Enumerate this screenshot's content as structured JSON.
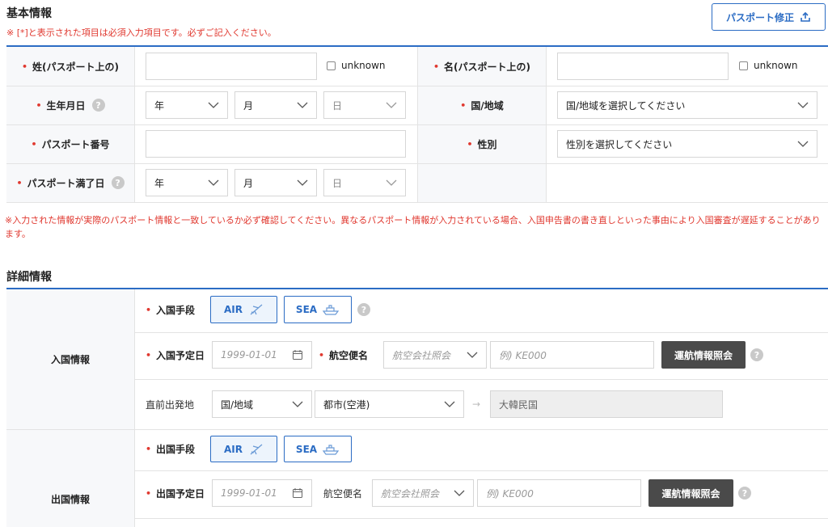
{
  "basic": {
    "title": "基本情報",
    "required_note": "※ [*]と表示された項目は必須入力項目です。必ずご記入ください。",
    "passport_edit_label": "パスポート修正",
    "surname_label": "姓(パスポート上の)",
    "given_label": "名(パスポート上の)",
    "unknown_label": "unknown",
    "dob_label": "生年月日",
    "year_placeholder": "年",
    "month_placeholder": "月",
    "day_placeholder": "日",
    "country_label": "国/地域",
    "country_placeholder": "国/地域を選択してください",
    "passport_no_label": "パスポート番号",
    "gender_label": "性別",
    "gender_placeholder": "性別を選択してください",
    "expiry_label": "パスポート満了日",
    "warning": "※入力された情報が実際のパスポート情報と一致しているか必ず確認してください。異なるパスポート情報が入力されている場合、入国申告書の書き直しといった事由により入国審査が遅延することがあります。",
    "help_glyph": "?",
    "star_glyph": "•"
  },
  "detail": {
    "title": "詳細情報",
    "entry": {
      "section_label": "入国情報",
      "mode_label": "入国手段",
      "air_label": "AIR",
      "sea_label": "SEA",
      "date_label": "入国予定日",
      "date_placeholder": "1999-01-01",
      "flight_label": "航空便名",
      "airline_placeholder": "航空会社照会",
      "flight_placeholder": "例) KE000",
      "lookup_label": "運航情報照会",
      "origin_label": "直前出発地",
      "origin_country": "国/地域",
      "origin_city": "都市(空港)",
      "destination": "大韓民国",
      "arrow_glyph": "→"
    },
    "exit": {
      "section_label": "出国情報",
      "mode_label": "出国手段",
      "air_label": "AIR",
      "sea_label": "SEA",
      "date_label": "出国予定日",
      "date_placeholder": "1999-01-01",
      "flight_label": "航空便名",
      "airline_placeholder": "航空会社照会",
      "flight_placeholder": "例) KE000",
      "lookup_label": "運航情報照会"
    }
  },
  "icons": {
    "upload": "upload-icon",
    "plane": "airplane-icon",
    "ship": "ship-icon",
    "calendar": "calendar-icon",
    "chevron": "chevron-down-icon",
    "help": "help-icon"
  }
}
